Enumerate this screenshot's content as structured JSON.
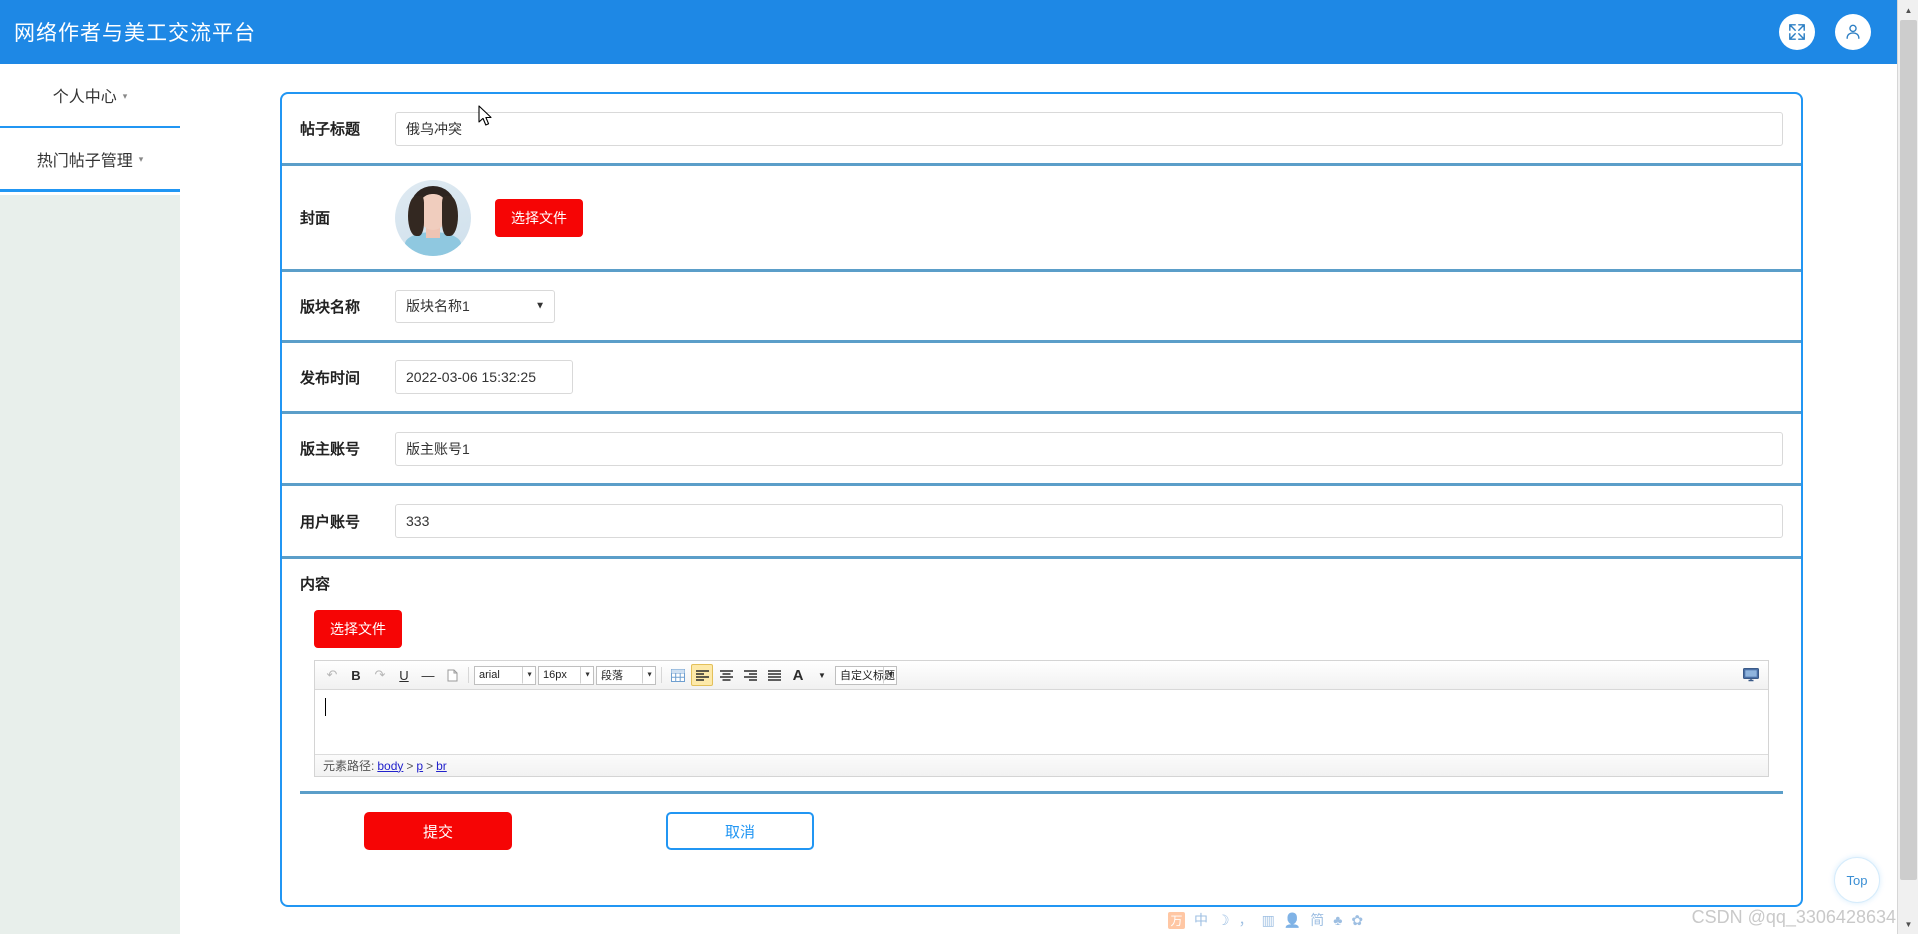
{
  "header": {
    "title": "网络作者与美工交流平台",
    "fullscreen_icon": "fullscreen-expand-icon",
    "user_icon": "user-avatar-icon"
  },
  "sidebar": {
    "items": [
      {
        "label": "个人中心",
        "caret": "▾"
      },
      {
        "label": "热门帖子管理",
        "caret": "▾"
      }
    ]
  },
  "form": {
    "title_field": {
      "label": "帖子标题",
      "value": "俄乌冲突",
      "placeholder": ""
    },
    "cover_field": {
      "label": "封面",
      "button": "选择文件"
    },
    "section_field": {
      "label": "版块名称",
      "value": "版块名称1",
      "options": [
        "版块名称1"
      ]
    },
    "time_field": {
      "label": "发布时间",
      "value": "2022-03-06 15:32:25"
    },
    "master_field": {
      "label": "版主账号",
      "value": "版主账号1"
    },
    "user_field": {
      "label": "用户账号",
      "value": "333"
    },
    "content_field": {
      "label": "内容",
      "button": "选择文件"
    }
  },
  "editor": {
    "toolbar": {
      "undo": "↶",
      "bold": "B",
      "redo": "↷",
      "underline": "U",
      "hr": "—",
      "page": "🗋",
      "font": "arial",
      "size": "16px",
      "paragraph": "段落",
      "table": "▦",
      "align_left": "≡",
      "align_center": "≡",
      "align_right": "≡",
      "justify": "≡",
      "text_color": "A",
      "custom_heading": "自定义标题",
      "fullscreen_preview": "monitor-icon"
    },
    "body_value": "",
    "status": {
      "label": "元素路径:",
      "path": [
        "body",
        "p",
        "br"
      ],
      "separator": ">"
    }
  },
  "actions": {
    "submit": "提交",
    "cancel": "取消"
  },
  "top_button": {
    "label": "Top"
  },
  "watermark": {
    "text": "CSDN @qq_3306428634"
  },
  "ime": {
    "items": [
      {
        "name": "ime-logo",
        "glyph": "万"
      },
      {
        "name": "ime-chinese-mode",
        "glyph": "中"
      },
      {
        "name": "ime-moon-icon",
        "glyph": "☽"
      },
      {
        "name": "ime-punctuation-icon",
        "glyph": "，"
      },
      {
        "name": "ime-keyboard-icon",
        "glyph": "▥"
      },
      {
        "name": "ime-person-icon",
        "glyph": "👤"
      },
      {
        "name": "ime-simplified-icon",
        "glyph": "简"
      },
      {
        "name": "ime-skin-icon",
        "glyph": "♣"
      },
      {
        "name": "ime-settings-icon",
        "glyph": "✿"
      }
    ]
  },
  "colors": {
    "brand_blue": "#1e88e5",
    "accent_blue": "#2196f3",
    "rule_blue": "#5b9ec9",
    "danger_red": "#f60505",
    "sidebar_fill": "#e8efeb"
  }
}
